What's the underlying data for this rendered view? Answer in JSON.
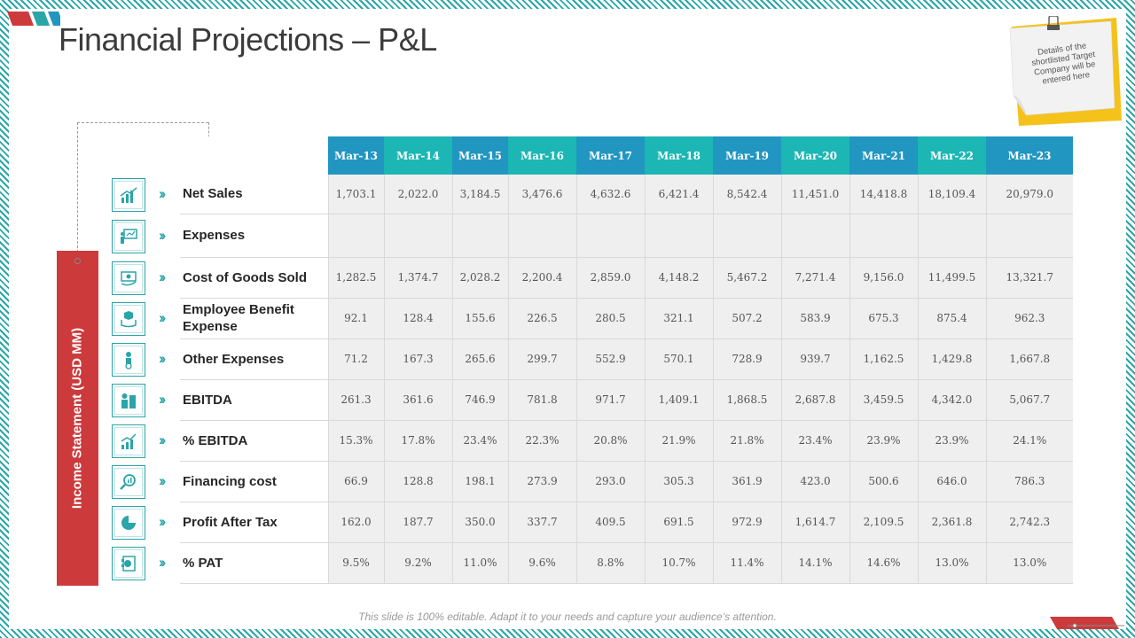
{
  "title": "Financial Projections – P&L",
  "sticky_note": "Details of the shortlisted Target Company will be entered here",
  "side_label": "Income Statement (USD MM)",
  "footer": "This slide is 100% editable. Adapt it to your needs and capture your audience’s attention.",
  "colors": {
    "accent_red": "#cd3a3c",
    "teal": "#1cb6b4",
    "blue": "#2196c0"
  },
  "table": {
    "columns": [
      "Mar-13",
      "Mar-14",
      "Mar-15",
      "Mar-16",
      "Mar-17",
      "Mar-18",
      "Mar-19",
      "Mar-20",
      "Mar-21",
      "Mar-22",
      "Mar-23"
    ],
    "rows": [
      {
        "label": "Net Sales",
        "icon": "bar-chart-icon",
        "values": [
          "1,703.1",
          "2,022.0",
          "3,184.5",
          "3,476.6",
          "4,632.6",
          "6,421.4",
          "8,542.4",
          "11,451.0",
          "14,418.8",
          "18,109.4",
          "20,979.0"
        ]
      },
      {
        "label": "Expenses",
        "icon": "presentation-icon",
        "values": [
          "",
          "",
          "",
          "",
          "",
          "",
          "",
          "",
          "",
          "",
          ""
        ]
      },
      {
        "label": "Cost of Goods Sold",
        "icon": "money-bill-icon",
        "values": [
          "1,282.5",
          "1,374.7",
          "2,028.2",
          "2,200.4",
          "2,859.0",
          "4,148.2",
          "5,467.2",
          "7,271.4",
          "9,156.0",
          "11,499.5",
          "13,321.7"
        ]
      },
      {
        "label": "Employee Benefit Expense",
        "icon": "hand-box-icon",
        "values": [
          "92.1",
          "128.4",
          "155.6",
          "226.5",
          "280.5",
          "321.1",
          "507.2",
          "583.9",
          "675.3",
          "875.4",
          "962.3"
        ]
      },
      {
        "label": "Other Expenses",
        "icon": "person-dollar-icon",
        "values": [
          "71.2",
          "167.3",
          "265.6",
          "299.7",
          "552.9",
          "570.1",
          "728.9",
          "939.7",
          "1,162.5",
          "1,429.8",
          "1,667.8"
        ]
      },
      {
        "label": "EBITDA",
        "icon": "coin-stack-icon",
        "values": [
          "261.3",
          "361.6",
          "746.9",
          "781.8",
          "971.7",
          "1,409.1",
          "1,868.5",
          "2,687.8",
          "3,459.5",
          "4,342.0",
          "5,067.7"
        ]
      },
      {
        "label": "% EBITDA",
        "icon": "growth-chart-icon",
        "values": [
          "15.3%",
          "17.8%",
          "23.4%",
          "22.3%",
          "20.8%",
          "21.9%",
          "21.8%",
          "23.4%",
          "23.9%",
          "23.9%",
          "24.1%"
        ]
      },
      {
        "label": "Financing cost",
        "icon": "magnifier-chart-icon",
        "values": [
          "66.9",
          "128.8",
          "198.1",
          "273.9",
          "293.0",
          "305.3",
          "361.9",
          "423.0",
          "500.6",
          "646.0",
          "786.3"
        ]
      },
      {
        "label": "Profit After Tax",
        "icon": "pie-chart-icon",
        "values": [
          "162.0",
          "187.7",
          "350.0",
          "337.7",
          "409.5",
          "691.5",
          "972.9",
          "1,614.7",
          "2,109.5",
          "2,361.8",
          "2,742.3"
        ]
      },
      {
        "label": "% PAT",
        "icon": "dollar-document-icon",
        "values": [
          "9.5%",
          "9.2%",
          "11.0%",
          "9.6%",
          "8.8%",
          "10.7%",
          "11.4%",
          "14.1%",
          "14.6%",
          "13.0%",
          "13.0%"
        ]
      }
    ]
  }
}
